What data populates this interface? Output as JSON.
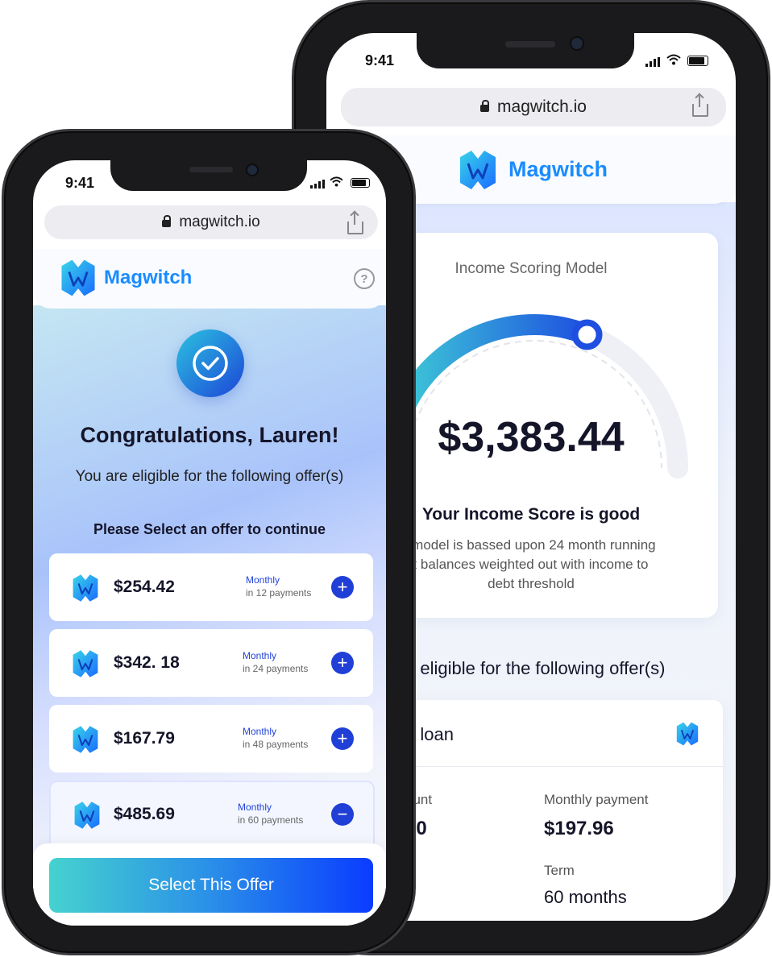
{
  "back_phone": {
    "status_time": "9:41",
    "url": "magwitch.io",
    "brand": "Magwitch",
    "card_title": "Income Scoring Model",
    "score_value": "$3,383.44",
    "score_headline": "Your Income Score is good",
    "score_desc_line1": "g model is bassed upon 24 month running",
    "score_desc_line2": "nt balances weighted out with income to",
    "score_desc_line3": "debt threshold",
    "offers_heading": "e eligible for the following offer(s)",
    "loan_title": "e loan",
    "amount_label": "ount",
    "amount_value": "00",
    "monthly_payment_label": "Monthly payment",
    "monthly_payment_value": "$197.96",
    "term_label": "Term",
    "term_value": "60 months",
    "gauge_progress": 0.62
  },
  "front_phone": {
    "status_time": "9:41",
    "url": "magwitch.io",
    "brand": "Magwitch",
    "congrats": "Congratulations, Lauren!",
    "eligible_text": "You are eligible for the following offer(s)",
    "select_prompt": "Please Select an offer to continue",
    "offers": [
      {
        "amount": "$254.42",
        "monthly": "Monthly",
        "payments": "in 12 payments",
        "toggle": "+"
      },
      {
        "amount": "$342. 18",
        "monthly": "Monthly",
        "payments": "in 24 payments",
        "toggle": "+"
      },
      {
        "amount": "$167.79",
        "monthly": "Monthly",
        "payments": "in 48 payments",
        "toggle": "+"
      },
      {
        "amount": "$485.69",
        "monthly": "Monthly",
        "payments": "in 60 payments",
        "toggle": "−"
      }
    ],
    "cta": "Select This Offer"
  },
  "icons": [
    "lock-icon",
    "share-icon",
    "help-icon",
    "check-icon",
    "plus-icon",
    "minus-icon",
    "magwitch-logo-icon",
    "signal-icon",
    "wifi-icon",
    "battery-icon"
  ],
  "colors": {
    "brand_blue": "#1a8cff",
    "accent_blue": "#1f3fd6",
    "gauge_start": "#3fd0d6",
    "gauge_end": "#1e4fe0",
    "cta_start": "#45d2cf",
    "cta_end": "#0a3cff"
  }
}
